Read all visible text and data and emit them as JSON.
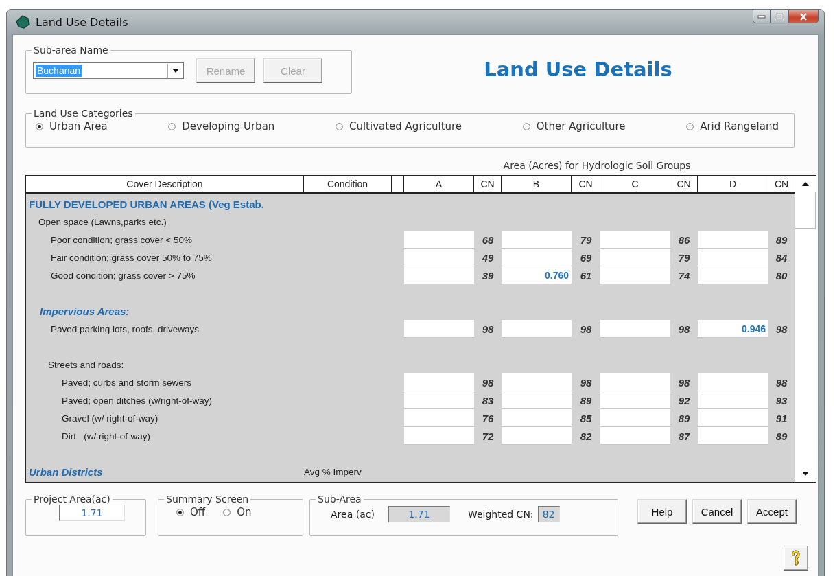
{
  "window": {
    "title": "Land Use Details"
  },
  "sub_area": {
    "legend": "Sub-area Name",
    "name": "Buchanan",
    "name_selected": true,
    "buttons": [
      {
        "label": "Rename",
        "disabled": true
      },
      {
        "label": "Clear",
        "disabled": true
      }
    ]
  },
  "heading": "Land Use Details",
  "categories": {
    "legend": "Land Use Categories",
    "options": [
      {
        "label": "Urban Area",
        "selected": true
      },
      {
        "label": "Developing Urban",
        "selected": false
      },
      {
        "label": "Cultivated Agriculture",
        "selected": false
      },
      {
        "label": "Other Agriculture",
        "selected": false
      },
      {
        "label": "Arid Rangeland",
        "selected": false
      }
    ]
  },
  "table": {
    "group_header": "Area (Acres) for Hydrologic Soil Groups",
    "columns": [
      "Cover Description",
      "Condition",
      "A",
      "CN",
      "B",
      "CN",
      "C",
      "CN",
      "D",
      "CN"
    ],
    "rows": [
      {
        "kind": "section",
        "text": "FULLY DEVELOPED URBAN AREAS (Veg Estab.",
        "children": [
          {
            "kind": "group",
            "text": "Open space (Lawns,parks etc.)",
            "children": [
              {
                "kind": "item",
                "text": "Poor condition; grass cover < 50%",
                "soil": [
                  {
                    "cn": "68"
                  },
                  {
                    "cn": "79"
                  },
                  {
                    "cn": "86"
                  },
                  {
                    "cn": "89"
                  }
                ]
              },
              {
                "kind": "item",
                "text": "Fair condition; grass cover 50% to 75%",
                "soil": [
                  {
                    "cn": "49"
                  },
                  {
                    "cn": "69"
                  },
                  {
                    "cn": "79"
                  },
                  {
                    "cn": "84"
                  }
                ]
              },
              {
                "kind": "item",
                "text": "Good condition; grass cover > 75%",
                "soil": [
                  {
                    "cn": "39"
                  },
                  {
                    "area": "0.760",
                    "cn": "61"
                  },
                  {
                    "cn": "74"
                  },
                  {
                    "cn": "80"
                  }
                ]
              }
            ]
          },
          {
            "kind": "heading",
            "text": "Impervious Areas:",
            "children": [
              {
                "kind": "item",
                "text": "Paved parking lots, roofs, driveways",
                "soil": [
                  {
                    "cn": "98"
                  },
                  {
                    "cn": "98"
                  },
                  {
                    "cn": "98"
                  },
                  {
                    "area": "0.946",
                    "cn": "98"
                  }
                ]
              },
              {
                "kind": "group",
                "text": "Streets and roads:",
                "children": [
                  {
                    "kind": "item",
                    "text": "Paved; curbs and storm sewers",
                    "soil": [
                      {
                        "cn": "98"
                      },
                      {
                        "cn": "98"
                      },
                      {
                        "cn": "98"
                      },
                      {
                        "cn": "98"
                      }
                    ]
                  },
                  {
                    "kind": "item",
                    "text": "Paved; open ditches (w/right-of-way)",
                    "soil": [
                      {
                        "cn": "83"
                      },
                      {
                        "cn": "89"
                      },
                      {
                        "cn": "92"
                      },
                      {
                        "cn": "93"
                      }
                    ]
                  },
                  {
                    "kind": "item",
                    "text": "Gravel (w/ right-of-way)",
                    "soil": [
                      {
                        "cn": "76"
                      },
                      {
                        "cn": "85"
                      },
                      {
                        "cn": "89"
                      },
                      {
                        "cn": "91"
                      }
                    ]
                  },
                  {
                    "kind": "item",
                    "text": "Dirt   (w/ right-of-way)",
                    "soil": [
                      {
                        "cn": "72"
                      },
                      {
                        "cn": "82"
                      },
                      {
                        "cn": "87"
                      },
                      {
                        "cn": "89"
                      }
                    ]
                  }
                ]
              }
            ]
          }
        ]
      },
      {
        "kind": "heading",
        "text": "Urban Districts",
        "condition": "Avg % Imperv"
      }
    ]
  },
  "project_area": {
    "legend": "Project Area(ac)",
    "value": "1.71"
  },
  "summary_screen": {
    "legend": "Summary Screen",
    "options": [
      {
        "label": "Off",
        "selected": true
      },
      {
        "label": "On",
        "selected": false
      }
    ]
  },
  "sub_area_result": {
    "legend": "Sub-Area",
    "area_label": "Area (ac)",
    "area": "1.71",
    "cn_label": "Weighted CN:",
    "weighted_cn": "82"
  },
  "buttons": [
    {
      "label": "Help"
    },
    {
      "label": "Cancel"
    },
    {
      "label": "Accept"
    }
  ]
}
